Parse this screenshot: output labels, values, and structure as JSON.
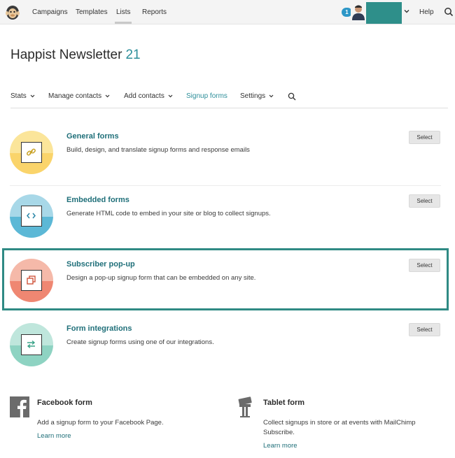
{
  "topnav": {
    "links": [
      "Campaigns",
      "Templates",
      "Lists",
      "Reports"
    ],
    "notification_count": "1",
    "help": "Help",
    "account_color": "#2e8f8a"
  },
  "page": {
    "title": "Happist Newsletter",
    "count": "21"
  },
  "subnav": {
    "items": [
      "Stats",
      "Manage contacts",
      "Add contacts",
      "Signup forms",
      "Settings"
    ],
    "active": "Signup forms"
  },
  "forms": [
    {
      "title": "General forms",
      "desc": "Build, design, and translate signup forms and response emails",
      "button": "Select",
      "icon": "link-icon",
      "color_top": "#fbe59a",
      "color_bottom": "#fad46b"
    },
    {
      "title": "Embedded forms",
      "desc": "Generate HTML code to embed in your site or blog to collect signups.",
      "button": "Select",
      "icon": "code-icon",
      "color_top": "#a8d8e8",
      "color_bottom": "#5cb8d6"
    },
    {
      "title": "Subscriber pop-up",
      "desc": "Design a pop-up signup form that can be embedded on any site.",
      "button": "Select",
      "icon": "popup-icon",
      "color_top": "#f5b9a9",
      "color_bottom": "#ef8772"
    },
    {
      "title": "Form integrations",
      "desc": "Create signup forms using one of our integrations.",
      "button": "Select",
      "icon": "swap-icon",
      "color_top": "#bfe6dc",
      "color_bottom": "#8ed3c2"
    }
  ],
  "bottom": [
    {
      "title": "Facebook form",
      "desc": "Add a signup form to your Facebook Page.",
      "link": "Learn more",
      "icon": "facebook-icon"
    },
    {
      "title": "Tablet form",
      "desc": "Collect signups in store or at events with MailChimp Subscribe.",
      "link": "Learn more",
      "icon": "tablet-stand-icon"
    }
  ]
}
